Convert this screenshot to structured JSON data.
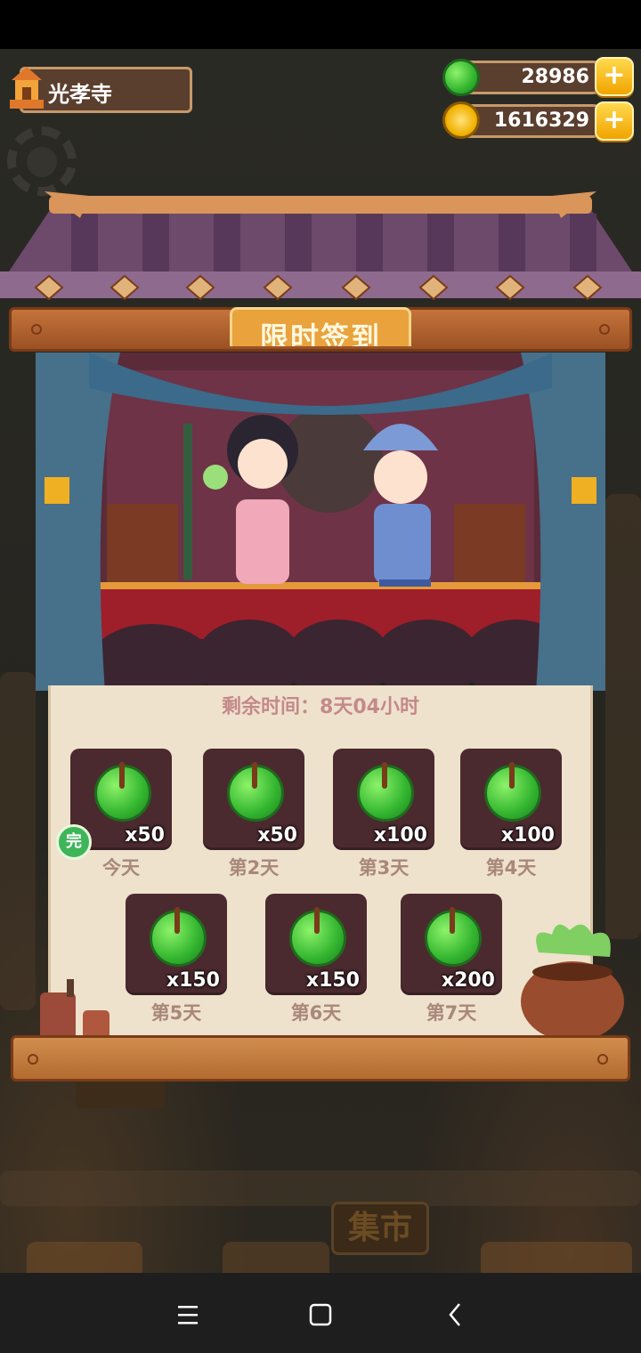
{
  "header": {
    "location": "光孝寺",
    "jade_amount": "28986",
    "coin_amount": "1616329",
    "plus_symbol": "+"
  },
  "panel": {
    "title": "限时签到",
    "timer": "剩余时间：8天04小时",
    "done_badge": "完"
  },
  "days": [
    {
      "label": "今天",
      "amount": "x50"
    },
    {
      "label": "第2天",
      "amount": "x50"
    },
    {
      "label": "第3天",
      "amount": "x100"
    },
    {
      "label": "第4天",
      "amount": "x100"
    },
    {
      "label": "第5天",
      "amount": "x150"
    },
    {
      "label": "第6天",
      "amount": "x150"
    },
    {
      "label": "第7天",
      "amount": "x200"
    }
  ],
  "background": {
    "market_sign": "集市"
  },
  "colors": {
    "jade": "#33b52f",
    "panel_bg": "#efe2cc",
    "tile_bg": "#4a2a2f",
    "gold": "#f0a400"
  },
  "icons": [
    "temple-icon",
    "jade-icon",
    "coin-icon",
    "plus-icon",
    "completed-badge",
    "menu-icon",
    "home-icon",
    "back-icon"
  ]
}
